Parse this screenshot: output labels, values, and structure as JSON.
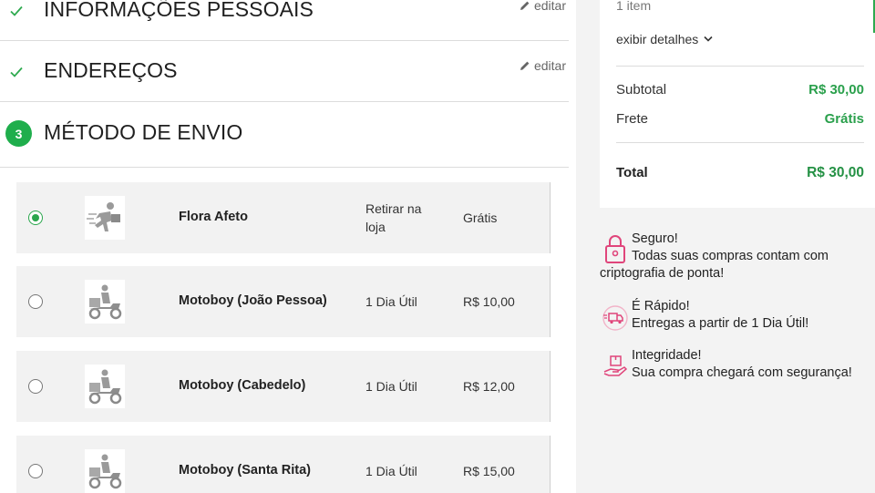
{
  "steps": {
    "personal": {
      "title": "INFORMAÇÕES PESSOAIS",
      "edit_label": "editar"
    },
    "address": {
      "title": "ENDEREÇOS",
      "edit_label": "editar"
    },
    "shipping": {
      "number": "3",
      "title": "MÉTODO DE ENVIO"
    }
  },
  "shipping_options": [
    {
      "name": "Flora Afeto",
      "time": "Retirar na loja",
      "price": "Grátis",
      "selected": true,
      "icon": "running-courier-icon"
    },
    {
      "name": "Motoboy (João Pessoa)",
      "time": "1 Dia Útil",
      "price": "R$ 10,00",
      "selected": false,
      "icon": "motorcycle-delivery-icon"
    },
    {
      "name": "Motoboy (Cabedelo)",
      "time": "1 Dia Útil",
      "price": "R$ 12,00",
      "selected": false,
      "icon": "motorcycle-delivery-icon"
    },
    {
      "name": "Motoboy (Santa Rita)",
      "time": "1 Dia Útil",
      "price": "R$ 15,00",
      "selected": false,
      "icon": "motorcycle-delivery-icon"
    }
  ],
  "summary": {
    "items_count": "1 item",
    "details_label": "exibir detalhes",
    "subtotal_label": "Subtotal",
    "subtotal_value": "R$ 30,00",
    "shipping_label": "Frete",
    "shipping_value": "Grátis",
    "total_label": "Total",
    "total_value": "R$ 30,00"
  },
  "features": [
    {
      "icon": "padlock-icon",
      "title": "Seguro!",
      "line1": "Todas suas compras contam com",
      "line2": "criptografia de ponta!"
    },
    {
      "icon": "delivery-truck-icon",
      "title": "É Rápido!",
      "line1": "Entregas a partir de 1 Dia Útil!",
      "line2": ""
    },
    {
      "icon": "package-hand-icon",
      "title": "Integridade!",
      "line1": "Sua compra chegará com segurança!",
      "line2": ""
    }
  ],
  "colors": {
    "accent_green": "#2aa64c",
    "price_green": "#2aa04c",
    "feature_icon_pink": "#e0457b"
  }
}
